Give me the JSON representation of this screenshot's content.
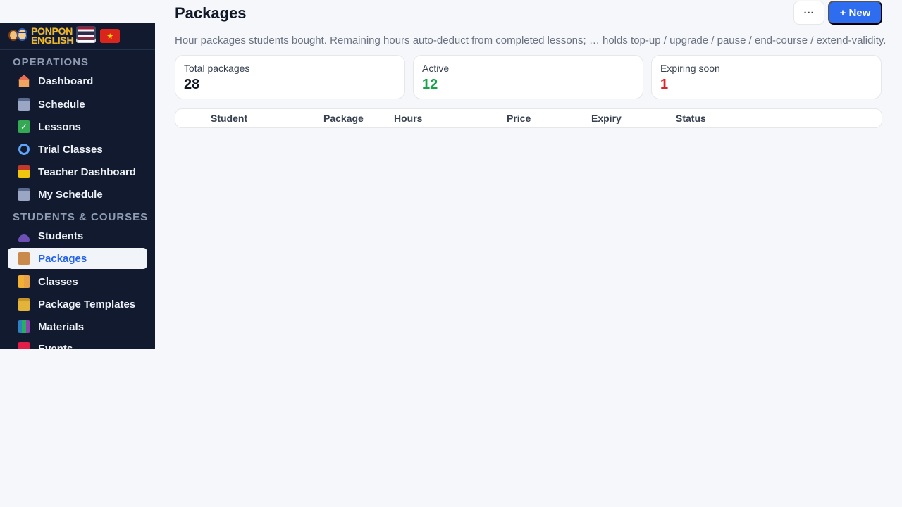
{
  "brand": {
    "line1": "PONPON",
    "line2": "ENGLISH",
    "flags": [
      "us-flag-icon",
      "vn-flag-icon",
      "th-flag-icon"
    ]
  },
  "sidebar": {
    "sections": [
      {
        "label": "OPERATIONS"
      },
      {
        "label": "STUDENTS & COURSES"
      }
    ],
    "items": [
      {
        "label": "Dashboard",
        "icon": "house-icon"
      },
      {
        "label": "Schedule",
        "icon": "calendar-icon"
      },
      {
        "label": "Lessons",
        "icon": "check-icon"
      },
      {
        "label": "Trial Classes",
        "icon": "magnifier-icon"
      },
      {
        "label": "Teacher Dashboard",
        "icon": "teacher-icon"
      },
      {
        "label": "My Schedule",
        "icon": "calendar-icon"
      },
      {
        "label": "Students",
        "icon": "users-icon"
      },
      {
        "label": "Packages",
        "icon": "package-icon",
        "active": true
      },
      {
        "label": "Classes",
        "icon": "class-icon"
      },
      {
        "label": "Package Templates",
        "icon": "folder-icon"
      },
      {
        "label": "Materials",
        "icon": "books-icon"
      },
      {
        "label": "Events",
        "icon": "event-icon"
      }
    ]
  },
  "header": {
    "title": "Packages",
    "more_label": "···",
    "new_label": "+ New",
    "subtitle": "Hour packages students bought. Remaining hours auto-deduct from completed lessons; … holds top-up / upgrade / pause / end-course / extend-validity."
  },
  "stats": [
    {
      "label": "Total packages",
      "value": "28"
    },
    {
      "label": "Active",
      "value": "12"
    },
    {
      "label": "Expiring soon",
      "value": "1"
    }
  ],
  "table": {
    "columns": [
      "Student",
      "Package",
      "Hours",
      "Price",
      "Expiry",
      "Status"
    ]
  },
  "colors": {
    "accent": "#2f6df0",
    "sidebar_bg": "#111a2e",
    "active_green": "#16a34a",
    "expiring_red": "#dc2626"
  }
}
